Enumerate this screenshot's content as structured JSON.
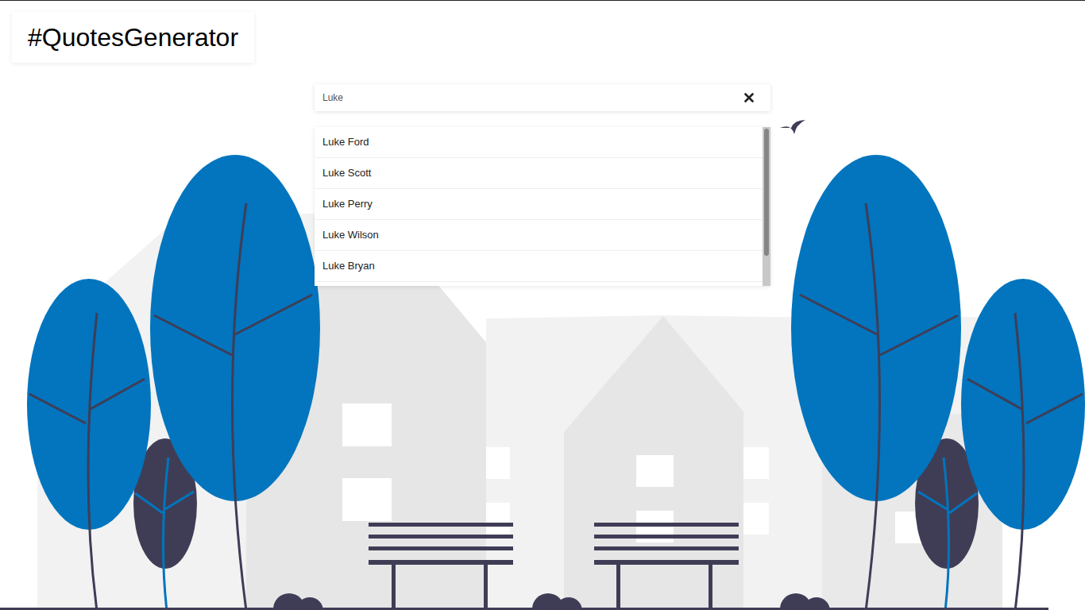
{
  "header": {
    "title": "#QuotesGenerator"
  },
  "search": {
    "value": "Luke"
  },
  "suggestions": [
    "Luke Ford",
    "Luke Scott",
    "Luke Perry",
    "Luke Wilson",
    "Luke Bryan"
  ]
}
